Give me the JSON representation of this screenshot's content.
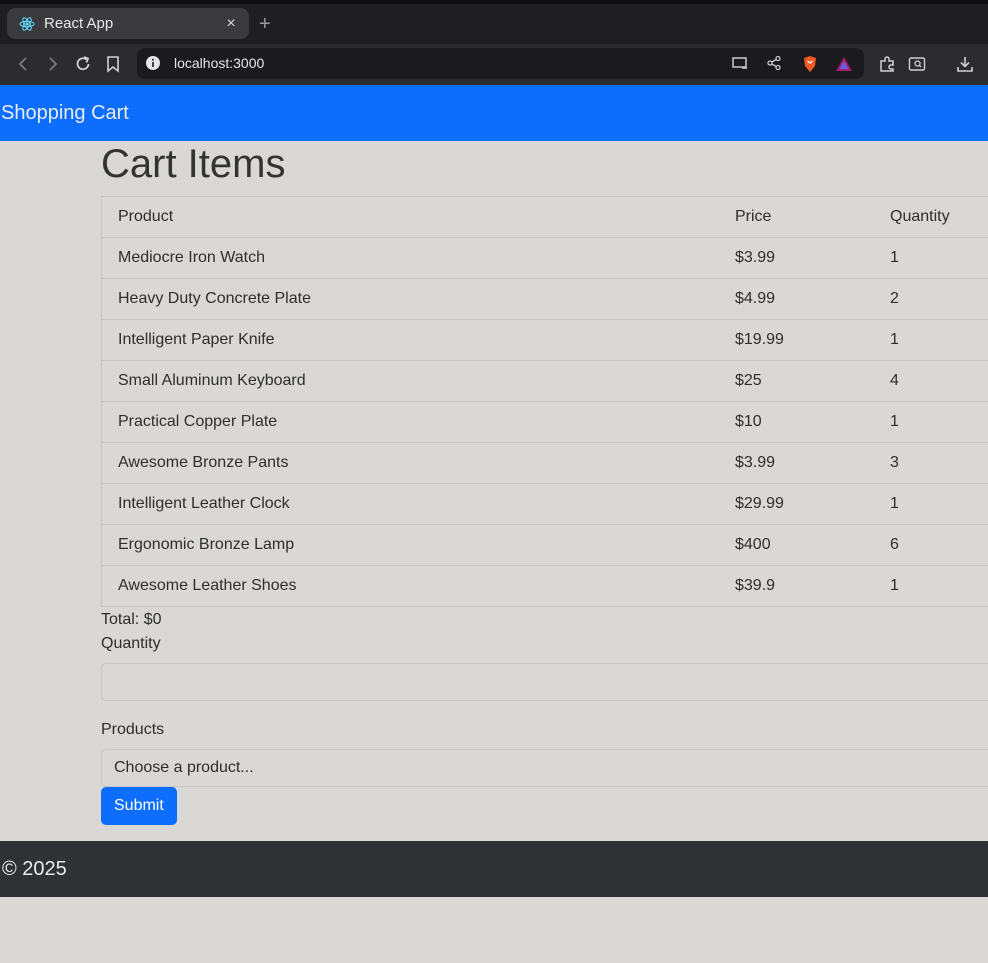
{
  "browser": {
    "tab_title": "React App",
    "tab_close": "×",
    "new_tab": "+",
    "url": "localhost:3000"
  },
  "navbar": {
    "brand": "Shopping Cart"
  },
  "main": {
    "heading": "Cart Items",
    "table": {
      "headers": [
        "Product",
        "Price",
        "Quantity"
      ],
      "rows": [
        [
          "Mediocre Iron Watch",
          "$3.99",
          "1"
        ],
        [
          "Heavy Duty Concrete Plate",
          "$4.99",
          "2"
        ],
        [
          "Intelligent Paper Knife",
          "$19.99",
          "1"
        ],
        [
          "Small Aluminum Keyboard",
          "$25",
          "4"
        ],
        [
          "Practical Copper Plate",
          "$10",
          "1"
        ],
        [
          "Awesome Bronze Pants",
          "$3.99",
          "3"
        ],
        [
          "Intelligent Leather Clock",
          "$29.99",
          "1"
        ],
        [
          "Ergonomic Bronze Lamp",
          "$400",
          "6"
        ],
        [
          "Awesome Leather Shoes",
          "$39.9",
          "1"
        ]
      ]
    },
    "total": "Total: $0",
    "quantity_label": "Quantity",
    "quantity_value": "",
    "products_label": "Products",
    "products_select": "Choose a product...",
    "submit_label": "Submit"
  },
  "footer": {
    "copyright": "© 2025"
  },
  "colors": {
    "navbar": "#0d6efd",
    "footer": "#2f3134",
    "page_bg": "#d9d8d4"
  }
}
